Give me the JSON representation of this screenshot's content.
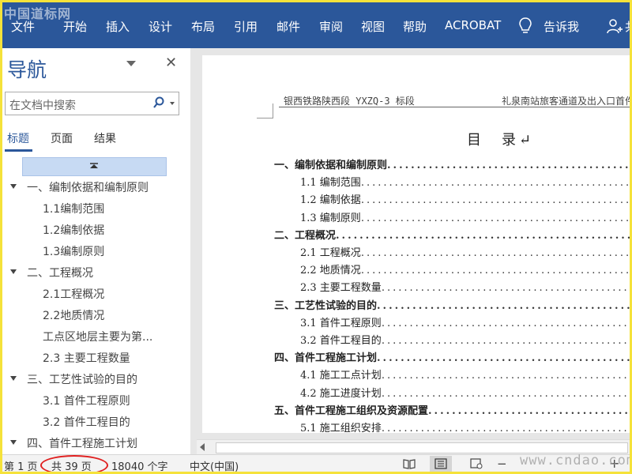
{
  "watermark_top": "中国道标网",
  "ribbon": {
    "tabs": [
      "文件",
      "开始",
      "插入",
      "设计",
      "布局",
      "引用",
      "邮件",
      "审阅",
      "视图",
      "帮助",
      "ACROBAT"
    ],
    "tell_me": "告诉我",
    "share": "共"
  },
  "nav": {
    "title": "导航",
    "search_placeholder": "在文档中搜索",
    "tabs": [
      "标题",
      "页面",
      "结果"
    ],
    "headings": [
      {
        "text": "一、编制依据和编制原则",
        "level": 1,
        "expanded": true
      },
      {
        "text": "1.1编制范围",
        "level": 2
      },
      {
        "text": "1.2编制依据",
        "level": 2
      },
      {
        "text": "1.3编制原则",
        "level": 2
      },
      {
        "text": "二、工程概况",
        "level": 1,
        "expanded": true
      },
      {
        "text": "2.1工程概况",
        "level": 2
      },
      {
        "text": "2.2地质情况",
        "level": 2
      },
      {
        "text": "工点区地层主要为第...",
        "level": 2
      },
      {
        "text": "2.3 主要工程数量",
        "level": 2
      },
      {
        "text": "三、工艺性试验的目的",
        "level": 1,
        "expanded": true
      },
      {
        "text": "3.1 首件工程原则",
        "level": 2
      },
      {
        "text": "3.2 首件工程目的",
        "level": 2
      },
      {
        "text": "四、首件工程施工计划",
        "level": 1,
        "expanded": true
      }
    ]
  },
  "document": {
    "header_left": "银西铁路陕西段 YXZQ-3 标段",
    "header_right": "礼泉南站旅客通道及出入口首件",
    "toc_title": "目　录↵",
    "toc": [
      {
        "text": "一、编制依据和编制原则",
        "level": 1
      },
      {
        "text": "1.1 编制范围",
        "level": 2
      },
      {
        "text": "1.2 编制依据",
        "level": 2
      },
      {
        "text": "1.3 编制原则",
        "level": 2
      },
      {
        "text": "二、工程概况",
        "level": 1
      },
      {
        "text": "2.1 工程概况",
        "level": 2
      },
      {
        "text": "2.2 地质情况",
        "level": 2
      },
      {
        "text": "2.3  主要工程数量",
        "level": 2
      },
      {
        "text": "三、工艺性试验的目的",
        "level": 1
      },
      {
        "text": "3.1  首件工程原则",
        "level": 2
      },
      {
        "text": "3.2  首件工程目的",
        "level": 2
      },
      {
        "text": "四、首件工程施工计划",
        "level": 1
      },
      {
        "text": "4.1  施工工点计划",
        "level": 2
      },
      {
        "text": "4.2  施工进度计划",
        "level": 2
      },
      {
        "text": "五、首件工程施工组织及资源配置",
        "level": 1
      },
      {
        "text": "5.1  施工组织安排",
        "level": 2
      }
    ]
  },
  "status": {
    "page": "第 1 页",
    "total_pages": "共 39 页",
    "word_count": "18040 个字",
    "language": "中文(中国)",
    "zoom_minus": "−",
    "zoom_plus": "+"
  },
  "watermark_bottom": "www.cndao.com",
  "colors": {
    "ribbon": "#2b579a",
    "accent": "#2b579a",
    "highlight_oval": "#e02020"
  }
}
